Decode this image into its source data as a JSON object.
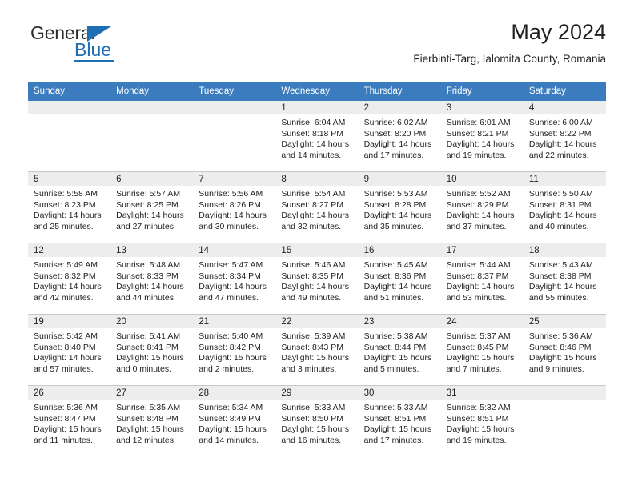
{
  "brand": {
    "name_top": "General",
    "name_bottom": "Blue",
    "triangle_color": "#1f6fb5",
    "text_color": "#2b2b2b",
    "accent_color": "#1f6fb5"
  },
  "header": {
    "title": "May 2024",
    "subtitle": "Fierbinti-Targ, Ialomita County, Romania"
  },
  "theme": {
    "header_row_bg": "#3a7cbe",
    "header_row_text": "#ffffff",
    "daynum_band_bg": "#ededed",
    "grid_line": "#c8c8c8",
    "body_text": "#231f20"
  },
  "weekday_headers": [
    "Sunday",
    "Monday",
    "Tuesday",
    "Wednesday",
    "Thursday",
    "Friday",
    "Saturday"
  ],
  "labels": {
    "sunrise_prefix": "Sunrise:",
    "sunset_prefix": "Sunset:",
    "daylight_prefix": "Daylight:"
  },
  "weeks": [
    [
      {
        "day": "",
        "empty": true
      },
      {
        "day": "",
        "empty": true
      },
      {
        "day": "",
        "empty": true
      },
      {
        "day": "1",
        "sunrise": "Sunrise: 6:04 AM",
        "sunset": "Sunset: 8:18 PM",
        "daylight_line1": "Daylight: 14 hours",
        "daylight_line2": "and 14 minutes."
      },
      {
        "day": "2",
        "sunrise": "Sunrise: 6:02 AM",
        "sunset": "Sunset: 8:20 PM",
        "daylight_line1": "Daylight: 14 hours",
        "daylight_line2": "and 17 minutes."
      },
      {
        "day": "3",
        "sunrise": "Sunrise: 6:01 AM",
        "sunset": "Sunset: 8:21 PM",
        "daylight_line1": "Daylight: 14 hours",
        "daylight_line2": "and 19 minutes."
      },
      {
        "day": "4",
        "sunrise": "Sunrise: 6:00 AM",
        "sunset": "Sunset: 8:22 PM",
        "daylight_line1": "Daylight: 14 hours",
        "daylight_line2": "and 22 minutes."
      }
    ],
    [
      {
        "day": "5",
        "sunrise": "Sunrise: 5:58 AM",
        "sunset": "Sunset: 8:23 PM",
        "daylight_line1": "Daylight: 14 hours",
        "daylight_line2": "and 25 minutes."
      },
      {
        "day": "6",
        "sunrise": "Sunrise: 5:57 AM",
        "sunset": "Sunset: 8:25 PM",
        "daylight_line1": "Daylight: 14 hours",
        "daylight_line2": "and 27 minutes."
      },
      {
        "day": "7",
        "sunrise": "Sunrise: 5:56 AM",
        "sunset": "Sunset: 8:26 PM",
        "daylight_line1": "Daylight: 14 hours",
        "daylight_line2": "and 30 minutes."
      },
      {
        "day": "8",
        "sunrise": "Sunrise: 5:54 AM",
        "sunset": "Sunset: 8:27 PM",
        "daylight_line1": "Daylight: 14 hours",
        "daylight_line2": "and 32 minutes."
      },
      {
        "day": "9",
        "sunrise": "Sunrise: 5:53 AM",
        "sunset": "Sunset: 8:28 PM",
        "daylight_line1": "Daylight: 14 hours",
        "daylight_line2": "and 35 minutes."
      },
      {
        "day": "10",
        "sunrise": "Sunrise: 5:52 AM",
        "sunset": "Sunset: 8:29 PM",
        "daylight_line1": "Daylight: 14 hours",
        "daylight_line2": "and 37 minutes."
      },
      {
        "day": "11",
        "sunrise": "Sunrise: 5:50 AM",
        "sunset": "Sunset: 8:31 PM",
        "daylight_line1": "Daylight: 14 hours",
        "daylight_line2": "and 40 minutes."
      }
    ],
    [
      {
        "day": "12",
        "sunrise": "Sunrise: 5:49 AM",
        "sunset": "Sunset: 8:32 PM",
        "daylight_line1": "Daylight: 14 hours",
        "daylight_line2": "and 42 minutes."
      },
      {
        "day": "13",
        "sunrise": "Sunrise: 5:48 AM",
        "sunset": "Sunset: 8:33 PM",
        "daylight_line1": "Daylight: 14 hours",
        "daylight_line2": "and 44 minutes."
      },
      {
        "day": "14",
        "sunrise": "Sunrise: 5:47 AM",
        "sunset": "Sunset: 8:34 PM",
        "daylight_line1": "Daylight: 14 hours",
        "daylight_line2": "and 47 minutes."
      },
      {
        "day": "15",
        "sunrise": "Sunrise: 5:46 AM",
        "sunset": "Sunset: 8:35 PM",
        "daylight_line1": "Daylight: 14 hours",
        "daylight_line2": "and 49 minutes."
      },
      {
        "day": "16",
        "sunrise": "Sunrise: 5:45 AM",
        "sunset": "Sunset: 8:36 PM",
        "daylight_line1": "Daylight: 14 hours",
        "daylight_line2": "and 51 minutes."
      },
      {
        "day": "17",
        "sunrise": "Sunrise: 5:44 AM",
        "sunset": "Sunset: 8:37 PM",
        "daylight_line1": "Daylight: 14 hours",
        "daylight_line2": "and 53 minutes."
      },
      {
        "day": "18",
        "sunrise": "Sunrise: 5:43 AM",
        "sunset": "Sunset: 8:38 PM",
        "daylight_line1": "Daylight: 14 hours",
        "daylight_line2": "and 55 minutes."
      }
    ],
    [
      {
        "day": "19",
        "sunrise": "Sunrise: 5:42 AM",
        "sunset": "Sunset: 8:40 PM",
        "daylight_line1": "Daylight: 14 hours",
        "daylight_line2": "and 57 minutes."
      },
      {
        "day": "20",
        "sunrise": "Sunrise: 5:41 AM",
        "sunset": "Sunset: 8:41 PM",
        "daylight_line1": "Daylight: 15 hours",
        "daylight_line2": "and 0 minutes."
      },
      {
        "day": "21",
        "sunrise": "Sunrise: 5:40 AM",
        "sunset": "Sunset: 8:42 PM",
        "daylight_line1": "Daylight: 15 hours",
        "daylight_line2": "and 2 minutes."
      },
      {
        "day": "22",
        "sunrise": "Sunrise: 5:39 AM",
        "sunset": "Sunset: 8:43 PM",
        "daylight_line1": "Daylight: 15 hours",
        "daylight_line2": "and 3 minutes."
      },
      {
        "day": "23",
        "sunrise": "Sunrise: 5:38 AM",
        "sunset": "Sunset: 8:44 PM",
        "daylight_line1": "Daylight: 15 hours",
        "daylight_line2": "and 5 minutes."
      },
      {
        "day": "24",
        "sunrise": "Sunrise: 5:37 AM",
        "sunset": "Sunset: 8:45 PM",
        "daylight_line1": "Daylight: 15 hours",
        "daylight_line2": "and 7 minutes."
      },
      {
        "day": "25",
        "sunrise": "Sunrise: 5:36 AM",
        "sunset": "Sunset: 8:46 PM",
        "daylight_line1": "Daylight: 15 hours",
        "daylight_line2": "and 9 minutes."
      }
    ],
    [
      {
        "day": "26",
        "sunrise": "Sunrise: 5:36 AM",
        "sunset": "Sunset: 8:47 PM",
        "daylight_line1": "Daylight: 15 hours",
        "daylight_line2": "and 11 minutes."
      },
      {
        "day": "27",
        "sunrise": "Sunrise: 5:35 AM",
        "sunset": "Sunset: 8:48 PM",
        "daylight_line1": "Daylight: 15 hours",
        "daylight_line2": "and 12 minutes."
      },
      {
        "day": "28",
        "sunrise": "Sunrise: 5:34 AM",
        "sunset": "Sunset: 8:49 PM",
        "daylight_line1": "Daylight: 15 hours",
        "daylight_line2": "and 14 minutes."
      },
      {
        "day": "29",
        "sunrise": "Sunrise: 5:33 AM",
        "sunset": "Sunset: 8:50 PM",
        "daylight_line1": "Daylight: 15 hours",
        "daylight_line2": "and 16 minutes."
      },
      {
        "day": "30",
        "sunrise": "Sunrise: 5:33 AM",
        "sunset": "Sunset: 8:51 PM",
        "daylight_line1": "Daylight: 15 hours",
        "daylight_line2": "and 17 minutes."
      },
      {
        "day": "31",
        "sunrise": "Sunrise: 5:32 AM",
        "sunset": "Sunset: 8:51 PM",
        "daylight_line1": "Daylight: 15 hours",
        "daylight_line2": "and 19 minutes."
      },
      {
        "day": "",
        "empty": true
      }
    ]
  ]
}
